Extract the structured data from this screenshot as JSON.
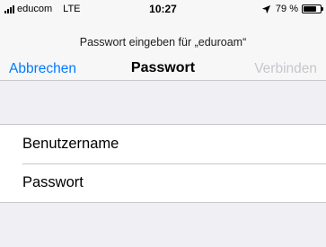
{
  "status_bar": {
    "carrier": "educom",
    "network": "LTE",
    "time": "10:27",
    "battery": "79 %",
    "battery_level": 0.79
  },
  "nav": {
    "prompt": "Passwort eingeben für „eduroam“",
    "cancel_label": "Abbrechen",
    "title": "Passwort",
    "connect_label": "Verbinden"
  },
  "form": {
    "username_placeholder": "Benutzername",
    "password_placeholder": "Passwort"
  },
  "colors": {
    "accent": "#007aff",
    "disabled": "#c7c7cc"
  }
}
